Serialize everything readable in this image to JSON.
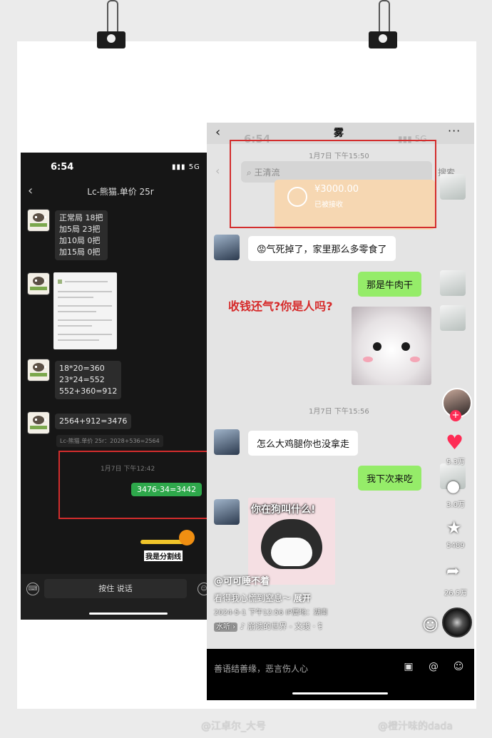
{
  "left_phone": {
    "status_time": "6:54",
    "status_signal": "5G",
    "back_icon": "‹",
    "chat_title": "Lc-熊猫.单价 25r",
    "messages": {
      "m1": [
        "正常局 18把",
        "加5局 23把",
        "加10局 0把",
        "加15局 0把"
      ],
      "m3": [
        "18*20=360",
        "23*24=552",
        "552+360=912"
      ],
      "m4": "2564+912=3476",
      "quote": "Lc-熊猫.单价 25r：2028+536=2564",
      "timestamp": "1月7日 下午12:42",
      "sent": "3476-34=3442"
    },
    "sticker_text": "我是分割线",
    "voice_button": "按住 说话",
    "keyboard_icon": "⌨",
    "emoji_icon": "☺"
  },
  "right_phone": {
    "status_time": "6:54",
    "status_signal": "5G",
    "chat_title": "雾",
    "back_icon": "‹",
    "more_icon": "···",
    "search_placeholder": "王清流",
    "search_action": "搜索",
    "timestamp1": "1月7日 下午15:50",
    "payment": {
      "amount": "¥3000.00",
      "status": "已被接收"
    },
    "msg1": "😡气死掉了，家里那么多零食了",
    "msg2": "那是牛肉干",
    "annotation": "收钱还气?你是人吗?",
    "timestamp2": "1月7日 下午15:56",
    "msg3": "怎么大鸡腿你也没拿走",
    "msg4": "我下次来吃",
    "sticker_caption": "你在狗叫什么!",
    "side": {
      "like_count": "5.3万",
      "comment_count": "3.0万",
      "fav_count": "5489",
      "share_count": "26.5万"
    },
    "author": "@可可睡不着",
    "description": "看得我心慌到窒息～",
    "expand": "展开",
    "meta": "2024-5-1 下午12:56  IP属地：湖南",
    "music_tag": "水听 ›",
    "music": "♪  崩溃的世界 - 文竣 · 钅",
    "comment_placeholder": "善语结善缘，恶言伤人心",
    "icons": [
      "image-icon",
      "at-icon",
      "emoji-icon"
    ]
  },
  "watermarks": [
    "@江卓尔_大号",
    "@橙汁味的dada"
  ],
  "colors": {
    "wechat_green": "#95ec69",
    "annotation_red": "#d62a2a",
    "like_red": "#fe2c55"
  }
}
